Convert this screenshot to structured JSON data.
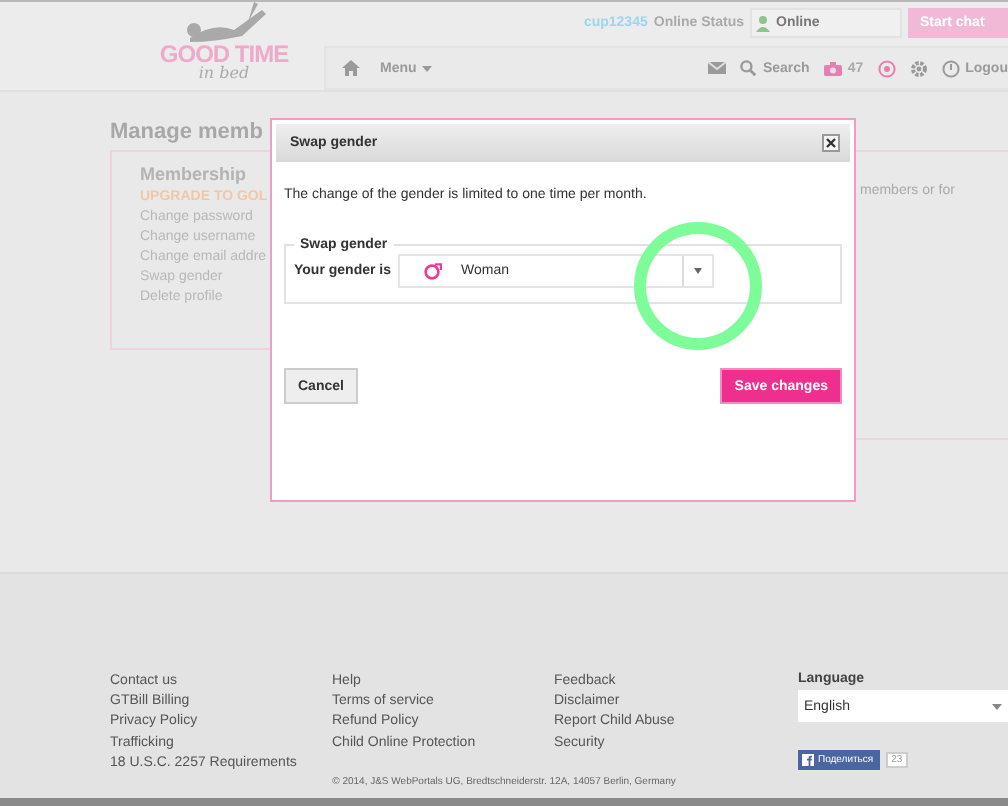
{
  "header": {
    "logo": {
      "title": "GOOD TIME",
      "subtitle": "in bed"
    },
    "username": "cup12345",
    "status_label": "Online Status",
    "status_select": {
      "value": "Online"
    },
    "start_chat": "Start chat",
    "nav": [
      {
        "kind": "home"
      },
      {
        "kind": "menu",
        "label": "Menu"
      },
      {
        "kind": "mail"
      },
      {
        "kind": "search",
        "label": "Search"
      },
      {
        "kind": "camera",
        "label": "47"
      },
      {
        "kind": "target"
      },
      {
        "kind": "gear"
      },
      {
        "kind": "logout",
        "label": "Logou"
      }
    ]
  },
  "page": {
    "title": "Manage memb",
    "membership": {
      "heading": "Membership",
      "links": [
        {
          "label": "UPGRADE TO GOL",
          "kind": "upgrade"
        },
        {
          "label": "Change password",
          "kind": "link"
        },
        {
          "label": "Change username",
          "kind": "link"
        },
        {
          "label": "Change email addre",
          "kind": "link"
        },
        {
          "label": "Swap gender",
          "kind": "link"
        },
        {
          "label": "Delete profile",
          "kind": "link"
        }
      ]
    },
    "side_text": "members or for"
  },
  "dialog": {
    "title": "Swap gender",
    "message": "The change of the gender is limited to one time per month.",
    "fieldset": {
      "legend": "Swap gender",
      "label": "Your gender is",
      "select": {
        "value": "Woman"
      }
    },
    "buttons": [
      {
        "label": "Cancel",
        "kind": "secondary"
      },
      {
        "label": "Save changes",
        "kind": "primary"
      }
    ]
  },
  "footer": {
    "columns": [
      [
        "Contact us",
        "GTBill Billing",
        "Privacy Policy",
        "Trafficking",
        "18 U.S.C. 2257 Requirements"
      ],
      [
        "Help",
        "Terms of service",
        "Refund Policy",
        "Child Online Protection"
      ],
      [
        "Feedback",
        "Disclaimer",
        "Report Child Abuse",
        "Security"
      ]
    ],
    "language": {
      "heading": "Language",
      "value": "English"
    },
    "share": {
      "label": "Поделиться",
      "count": "23"
    },
    "copyright": "© 2014, J&S WebPortals UG, Bredtschneiderstr. 12A, 14057 Berlin, Germany"
  }
}
